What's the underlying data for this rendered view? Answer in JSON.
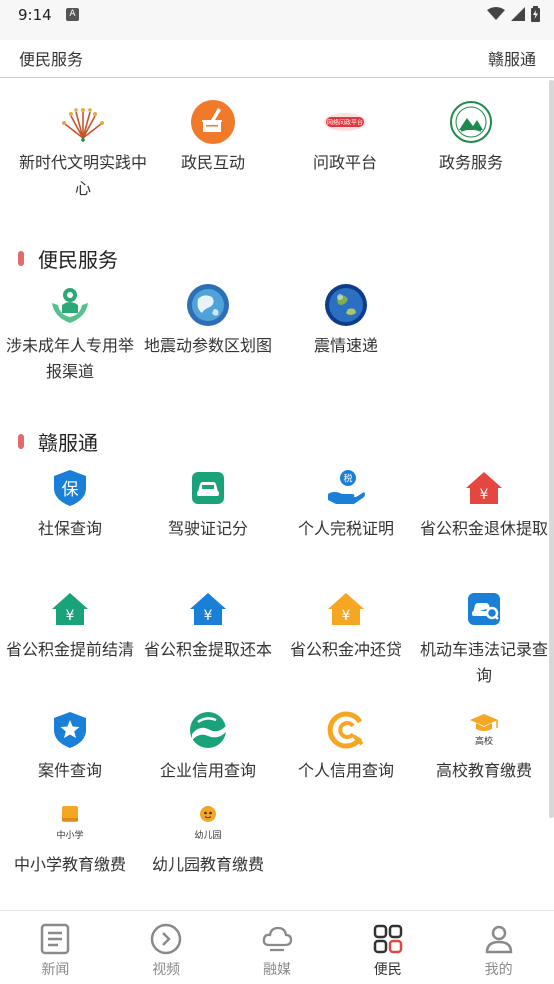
{
  "status_bar": {
    "time": "9:14",
    "notification": "A"
  },
  "header": {
    "left": "便民服务",
    "right": "赣服通"
  },
  "top_grid": [
    {
      "label": "新时代文明实践中心",
      "icon": "sunburst-icon"
    },
    {
      "label": "政民互动",
      "icon": "chat-icon"
    },
    {
      "label": "问政平台",
      "icon": "wenzheng-logo-icon",
      "logo_text": "网络问政平台"
    },
    {
      "label": "政务服务",
      "icon": "emblem-icon"
    }
  ],
  "section_bianmin": {
    "title": "便民服务",
    "items": [
      {
        "label": "涉未成年人专用举报渠道",
        "icon": "child-protection-icon"
      },
      {
        "label": "地震动参数区划图",
        "icon": "earth-map-icon"
      },
      {
        "label": "震情速递",
        "icon": "globe-icon"
      }
    ]
  },
  "section_ganfutong": {
    "title": "赣服通",
    "items": [
      {
        "label": "社保查询",
        "icon": "social-security-icon",
        "glyph": "保"
      },
      {
        "label": "驾驶证记分",
        "icon": "car-icon"
      },
      {
        "label": "个人完税证明",
        "icon": "tax-hand-icon",
        "glyph": "税"
      },
      {
        "label": "省公积金退休提取",
        "icon": "house-yen-icon",
        "glyph": "¥"
      },
      {
        "label": "省公积金提前结清",
        "icon": "house-yen-icon",
        "glyph": "¥"
      },
      {
        "label": "省公积金提取还本",
        "icon": "house-yen-icon",
        "glyph": "¥"
      },
      {
        "label": "省公积金冲还贷",
        "icon": "house-yen-icon",
        "glyph": "¥"
      },
      {
        "label": "机动车违法记录查询",
        "icon": "car-search-icon"
      },
      {
        "label": "案件查询",
        "icon": "star-shield-icon"
      },
      {
        "label": "企业信用查询",
        "icon": "wave-icon"
      },
      {
        "label": "个人信用查询",
        "icon": "credit-c-icon"
      },
      {
        "label": "高校教育缴费",
        "icon": "graduation-cap-icon",
        "sub": "高校"
      },
      {
        "label": "中小学教育缴费",
        "icon": "book-icon",
        "sub": "中小学"
      },
      {
        "label": "幼儿园教育缴费",
        "icon": "kindergarten-icon",
        "sub": "幼儿园"
      }
    ]
  },
  "bottom_nav": [
    {
      "label": "新闻",
      "icon": "news-icon",
      "active": false
    },
    {
      "label": "视频",
      "icon": "play-icon",
      "active": false
    },
    {
      "label": "融媒",
      "icon": "cloud-icon",
      "active": false
    },
    {
      "label": "便民",
      "icon": "grid-icon",
      "active": true
    },
    {
      "label": "我的",
      "icon": "person-icon",
      "active": false
    }
  ],
  "colors": {
    "accent_red": "#e16a6a",
    "blue": "#1a7fd6",
    "green": "#1aa37a",
    "orange": "#f5a623",
    "red": "#e4473f"
  }
}
